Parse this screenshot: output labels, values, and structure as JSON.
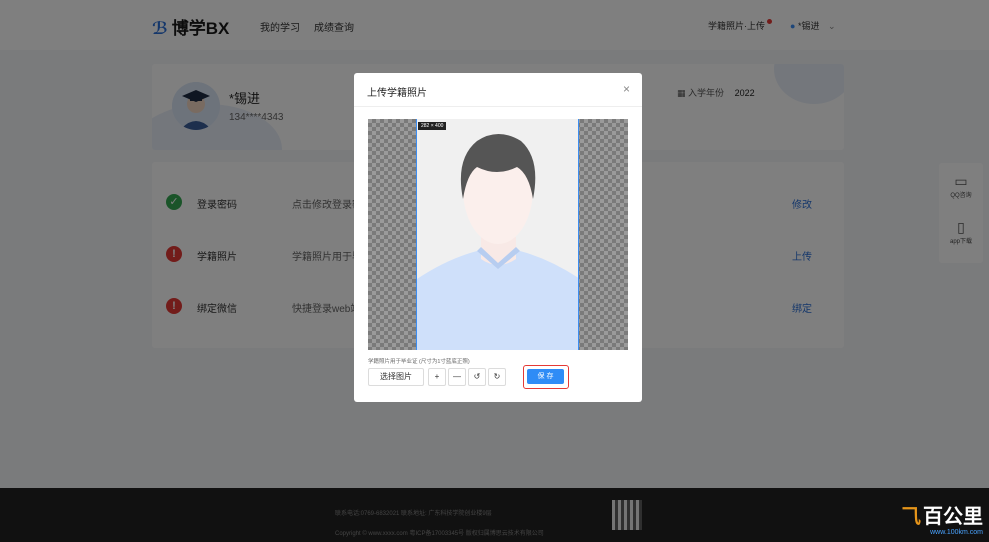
{
  "nav": {
    "logo_text": "博学BX",
    "links": [
      "我的学习",
      "成绩查询"
    ],
    "upload_label": "学籍照片·上传",
    "user_label": "*锡进"
  },
  "profile": {
    "name": "*锡进",
    "phone": "134****4343",
    "year_label": "入学年份",
    "year": "2022"
  },
  "security_rows": [
    {
      "title": "登录密码",
      "desc": "点击修改登录密",
      "action": "修改",
      "status": "ok"
    },
    {
      "title": "学籍照片",
      "desc": "学籍照片用于毕",
      "action": "上传",
      "status": "warn"
    },
    {
      "title": "绑定微信",
      "desc": "快捷登录web端",
      "action": "绑定",
      "status": "warn"
    }
  ],
  "side": {
    "qq": "QQ咨询",
    "app": "app下载"
  },
  "footer": {
    "line1": "联系电话:0769-6832021    联系地址: 广东科技学院创业楼9层",
    "line2": "Copyright © www.xxxx.com 粤ICP备17003345号    版权归属博思云技术有限公司"
  },
  "modal": {
    "title": "上传学籍照片",
    "close": "×",
    "dimension": "282 × 400",
    "hint": "学籍照片用于毕业证 (尺寸为1寸蓝底正照)",
    "choose_label": "选择图片",
    "zoom_in": "+",
    "zoom_out": "—",
    "rotate_left": "↺",
    "rotate_right": "↻",
    "save_label": "保 存"
  },
  "watermark": {
    "brand": "百公里",
    "url": "www.100km.com"
  },
  "colors": {
    "accent": "#2f8cf6",
    "ok": "#34a853",
    "warn": "#e53935",
    "highlight": "#e53935"
  }
}
